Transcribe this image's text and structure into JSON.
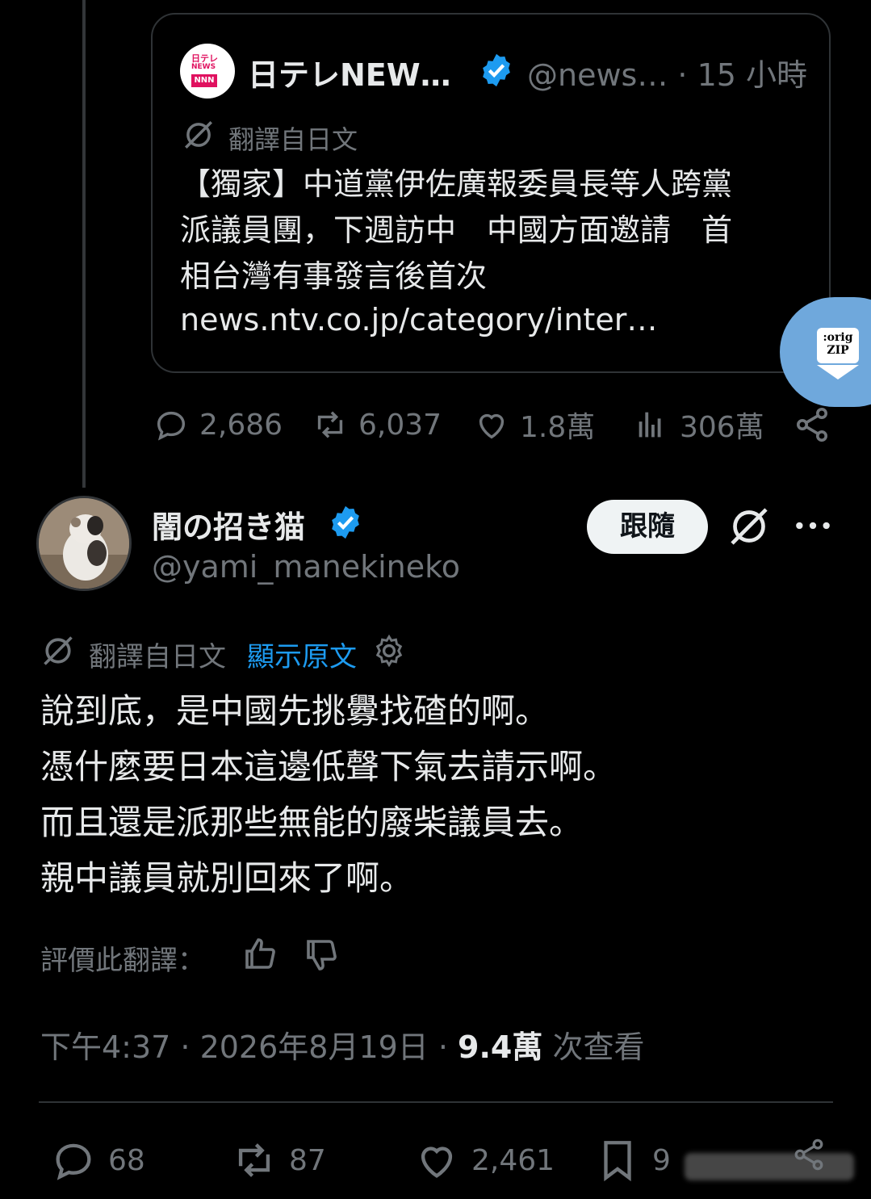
{
  "quoted": {
    "name": "日テレNEW…",
    "handle": "@news… · 15 小時",
    "logo_text_top": "日テレ",
    "logo_text_mid": "NEWS",
    "logo_text_bottom": "NNN",
    "translate_label": "翻譯自日文",
    "body": "【獨家】中道黨伊佐廣報委員長等人跨黨\n派議員團，下週訪中　中國方面邀請　首\n相台灣有事發言後首次",
    "link": "news.ntv.co.jp/category/inter…",
    "stats": {
      "replies": "2,686",
      "reposts": "6,037",
      "likes": "1.8萬",
      "views": "306萬"
    }
  },
  "zip_button": {
    "line1": ":orig",
    "line2": "ZIP"
  },
  "author": {
    "name": "闇の招き猫",
    "handle": "@yami_manekineko",
    "follow_label": "跟隨"
  },
  "translation": {
    "label": "翻譯自日文",
    "show_original": "顯示原文"
  },
  "post": {
    "lines": [
      "說到底，是中國先挑釁找碴的啊。",
      "憑什麼要日本這邊低聲下氣去請示啊。",
      "而且還是派那些無能的廢柴議員去。",
      "親中議員就別回來了啊。"
    ]
  },
  "rate_label": "評價此翻譯：",
  "meta": {
    "time": "下午4:37 · 2026年8月19日 · ",
    "views": "9.4萬",
    "views_label": " 次查看"
  },
  "bottom_stats": {
    "replies": "68",
    "reposts": "87",
    "likes": "2,461",
    "bookmarks": "9"
  },
  "colors": {
    "background": "#000000",
    "text": "#e7e9ea",
    "muted": "#71767b",
    "accent": "#1d9bf0",
    "zip_button": "#6fa8dc"
  },
  "icons": [
    "verified-badge-icon",
    "translate-icon",
    "reply-icon",
    "repost-icon",
    "like-icon",
    "views-icon",
    "share-icon",
    "grok-icon",
    "more-icon",
    "gear-icon",
    "thumb-up-icon",
    "thumb-down-icon",
    "bookmark-icon",
    "download-arrow-icon"
  ]
}
